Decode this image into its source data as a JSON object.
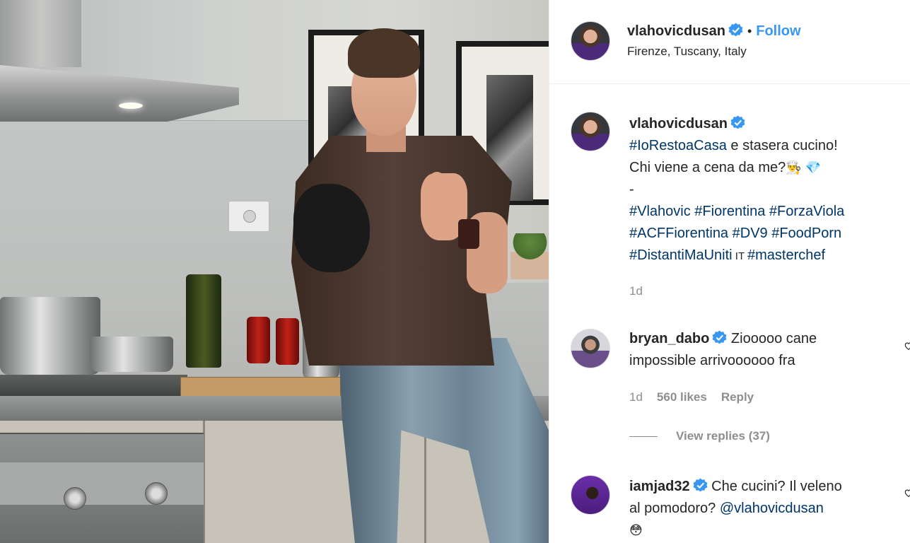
{
  "post": {
    "username": "vlahovicdusan",
    "follow_label": "Follow",
    "separator": "•",
    "location": "Firenze, Tuscany, Italy"
  },
  "caption": {
    "username": "vlahovicdusan",
    "line1_tag": "#IoRestoaCasa",
    "line1_rest": " e stasera cucino!",
    "line2": "Chi viene a cena da me?",
    "line2_emoji": "👨‍🍳 💎",
    "line3": "-",
    "tags_row1": [
      "#Vlahovic",
      "#Fiorentina",
      "#ForzaViola"
    ],
    "tags_row2": [
      "#ACFFiorentina",
      "#DV9",
      "#FoodPorn"
    ],
    "tags_row3_a": "#DistantiMaUniti",
    "tags_row3_mid": " IT ",
    "tags_row3_b": "#masterchef",
    "time": "1d"
  },
  "comments": [
    {
      "username": "bryan_dabo",
      "text_line1": "Ziooooo cane",
      "text_line2": "impossible arrivoooooo fra",
      "time": "1d",
      "likes": "560 likes",
      "reply": "Reply",
      "view_replies": "View replies (37)"
    },
    {
      "username": "iamjad32",
      "text_line1": "Che cucini? Il veleno",
      "text_line2": "al pomodoro?",
      "mention": "@vlahovicdusan",
      "emoji": "😳"
    }
  ],
  "colors": {
    "link": "#3897f0",
    "hashtag": "#003569",
    "muted": "#8e8e8e",
    "text": "#262626"
  },
  "icons": [
    "verified-badge-icon",
    "heart-icon"
  ]
}
